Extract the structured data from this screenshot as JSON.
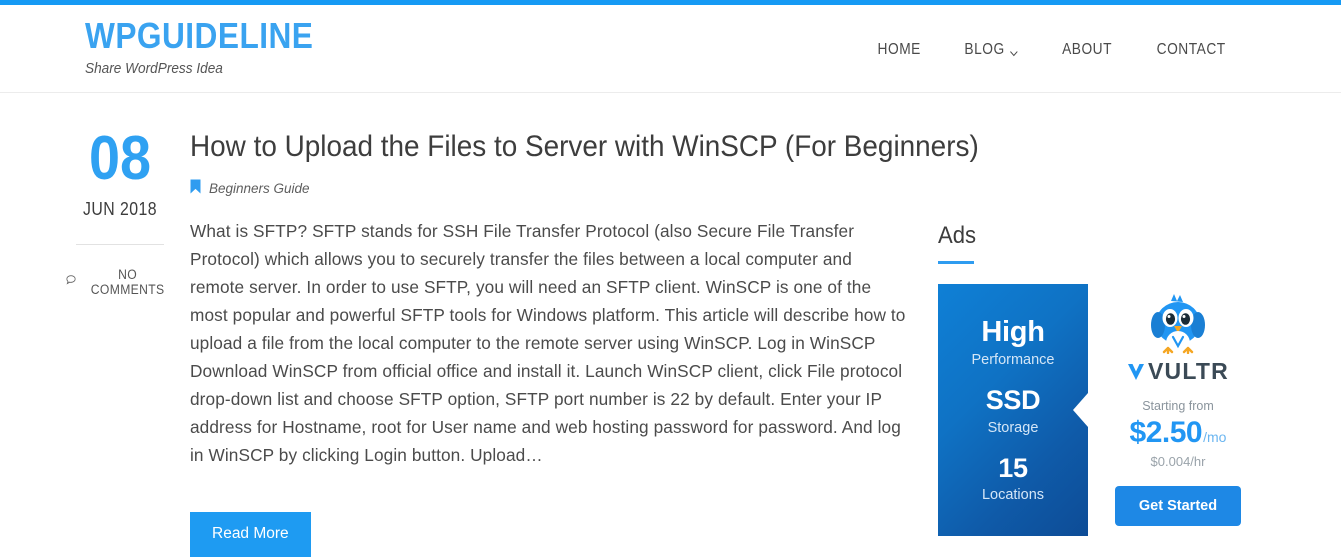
{
  "theme": {
    "accent_blue": "#159af4",
    "link_blue": "#2fa1f2",
    "button_blue": "#1e9bf2",
    "ad_button_blue": "#1e88e5",
    "text_dark": "#3d3d3d",
    "text_body": "#4b4b4b"
  },
  "header": {
    "brand_title": "WPGUIDELINE",
    "brand_tagline": "Share WordPress Idea",
    "nav": [
      {
        "label": "HOME",
        "has_caret": false
      },
      {
        "label": "BLOG",
        "has_caret": true
      },
      {
        "label": "ABOUT",
        "has_caret": false
      },
      {
        "label": "CONTACT",
        "has_caret": false
      }
    ]
  },
  "post": {
    "date_day": "08",
    "date_month_year": "JUN 2018",
    "comments_label": "NO COMMENTS",
    "comments_icon": "speech-bubble-icon",
    "title": "How to Upload the Files to Server with WinSCP (For Beginners)",
    "category_icon": "bookmark-icon",
    "category": "Beginners Guide",
    "excerpt": "What is SFTP? SFTP stands for SSH File Transfer Protocol (also Secure File Transfer Protocol) which allows you to securely transfer the files between a local computer and remote server. In order to use SFTP, you will need an SFTP client. WinSCP is one of the most popular and powerful SFTP tools for Windows platform. This article will describe how to upload a file from the local computer to the remote server using WinSCP. Log in WinSCP Download WinSCP from official office and install it. Launch WinSCP client, click File protocol drop-down list and choose SFTP option, SFTP port number is 22 by default. Enter your IP address for Hostname, root for User name and web hosting password for password. And log in WinSCP by clicking Login button.  Upload…",
    "read_more_label": "Read More"
  },
  "sidebar": {
    "ads_heading": "Ads",
    "ad": {
      "stats": [
        {
          "value": "High",
          "label": "Performance"
        },
        {
          "value": "SSD",
          "label": "Storage"
        },
        {
          "value": "15",
          "label": "Locations"
        }
      ],
      "brand_icon": "vultr-bird-icon",
      "brand_name": "VULTR",
      "starting_from": "Starting from",
      "price": "$2.50",
      "price_unit": "/mo",
      "price_hourly": "$0.004/hr",
      "cta_label": "Get Started"
    }
  }
}
